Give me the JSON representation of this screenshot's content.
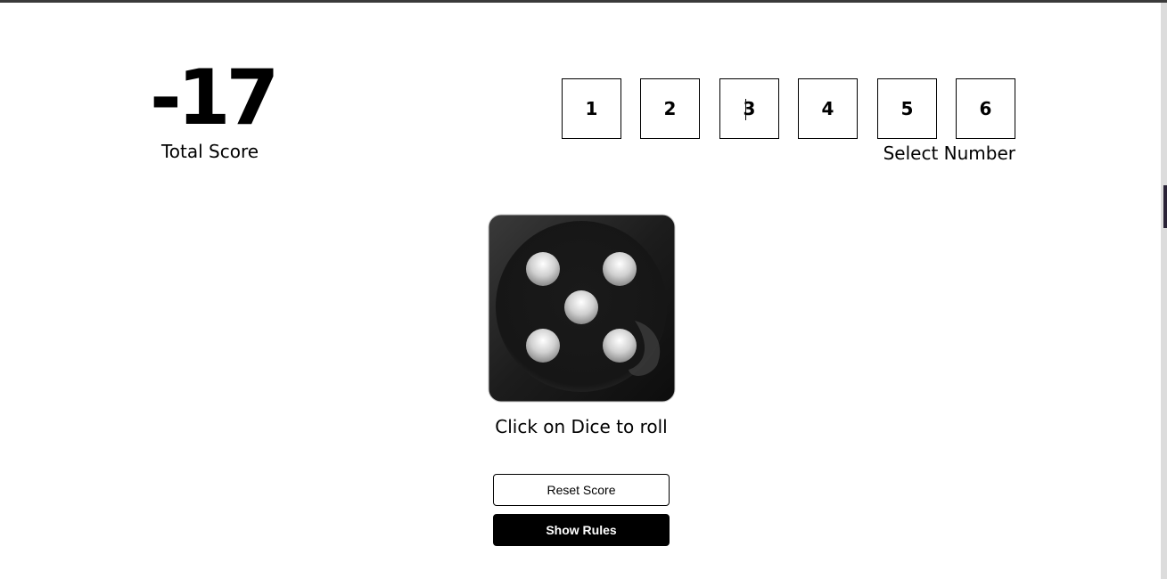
{
  "score": {
    "value": "-17",
    "label": "Total Score"
  },
  "numbers": {
    "options": [
      "1",
      "2",
      "3",
      "4",
      "5",
      "6"
    ],
    "label": "Select Number"
  },
  "dice": {
    "face_value": 5,
    "hint": "Click on Dice to roll"
  },
  "buttons": {
    "reset_label": "Reset Score",
    "rules_label": "Show Rules"
  }
}
